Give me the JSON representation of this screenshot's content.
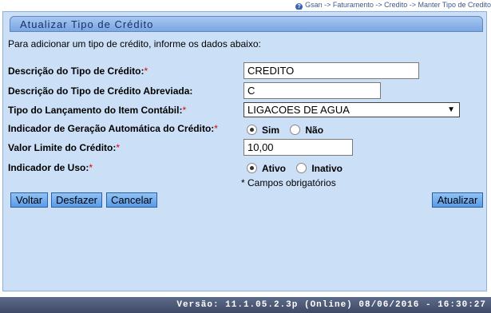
{
  "breadcrumb": "Gsan -> Faturamento -> Credito -> Manter Tipo de Credito",
  "panel": {
    "title": "Atualizar Tipo de Crédito",
    "intro": "Para adicionar um tipo de crédito, informe os dados abaixo:"
  },
  "form": {
    "descricao": {
      "label": "Descrição do Tipo de Crédito:",
      "required_mark": "*",
      "value": "CREDITO"
    },
    "abreviada": {
      "label": "Descrição do Tipo de Crédito Abreviada:",
      "value": "C"
    },
    "lancamento": {
      "label": "Tipo do Lançamento do Item Contábil:",
      "required_mark": "*",
      "value": "LIGACOES DE AGUA"
    },
    "geracao": {
      "label": "Indicador de Geração Automática do Crédito:",
      "required_mark": "*",
      "option_yes": "Sim",
      "option_no": "Não",
      "selected": "Sim"
    },
    "valor_limite": {
      "label": "Valor Limite do Crédito:",
      "required_mark": "*",
      "value": "10,00"
    },
    "uso": {
      "label": "Indicador de Uso:",
      "required_mark": "*",
      "option_active": "Ativo",
      "option_inactive": "Inativo",
      "selected": "Ativo"
    },
    "required_note": "* Campos obrigatórios"
  },
  "buttons": {
    "voltar": "Voltar",
    "desfazer": "Desfazer",
    "cancelar": "Cancelar",
    "atualizar": "Atualizar"
  },
  "footer": "Versão: 11.1.05.2.3p (Online) 08/06/2016 - 16:30:27",
  "icons": {
    "help": "help-icon",
    "dropdown": "chevron-down-icon"
  }
}
